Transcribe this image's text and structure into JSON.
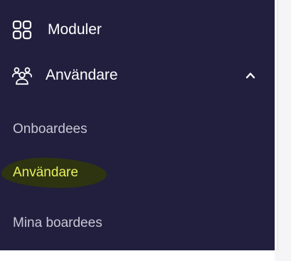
{
  "sidebar": {
    "background": "#211f3d",
    "items": [
      {
        "label": "Moduler",
        "icon": "grid-icon"
      },
      {
        "label": "Användare",
        "icon": "users-group-icon",
        "expanded": true,
        "toggle_icon": "chevron-up-icon"
      }
    ],
    "sub_items": [
      {
        "label": "Onboardees"
      },
      {
        "label": "Användare",
        "active": true,
        "highlight_color": "#e7f05a"
      },
      {
        "label": "Mina boardees"
      }
    ]
  }
}
